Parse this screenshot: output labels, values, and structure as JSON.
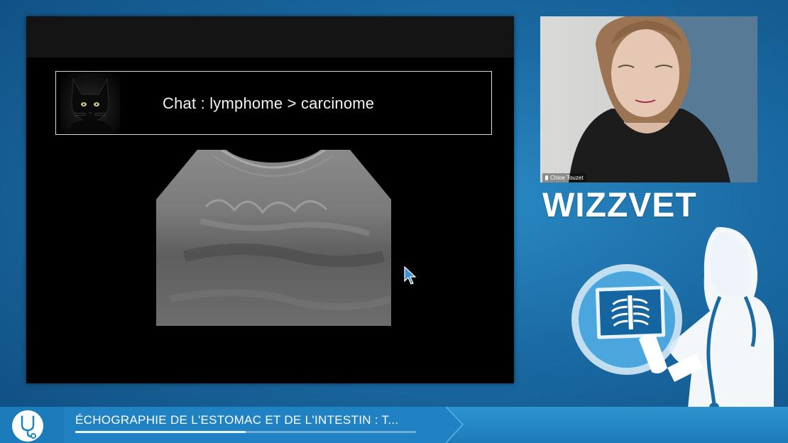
{
  "slide": {
    "title": "Chat : lymphome > carcinome"
  },
  "webcam": {
    "participant_name": "Chloe Touzet"
  },
  "brand": {
    "name": "WIZZVET"
  },
  "lower_third": {
    "video_title": "ÉCHOGRAPHIE DE L'ESTOMAC ET DE L'INTESTIN : T...",
    "progress": 0.5
  },
  "icons": {
    "logo": "stethoscope-logo-icon",
    "cursor": "mouse-pointer-icon",
    "mic": "microphone-icon",
    "xray": "xray-tablet-icon"
  },
  "colors": {
    "background": "#1a6aa3",
    "accent": "#2d94cf",
    "slide_bg": "#000000",
    "text": "#ffffff"
  }
}
